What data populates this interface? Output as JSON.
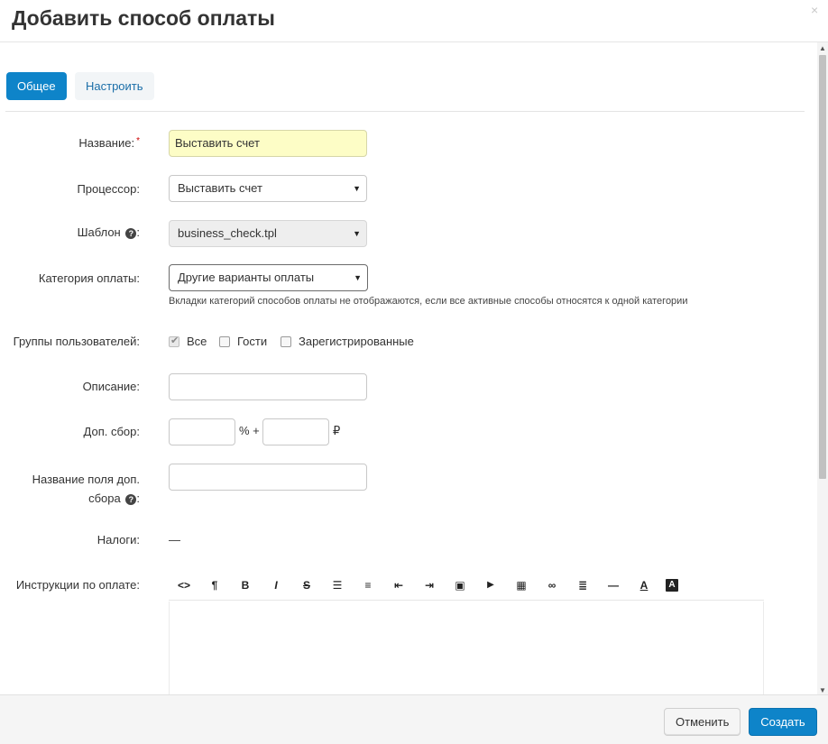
{
  "dialog": {
    "title": "Добавить способ оплаты",
    "close_glyph": "×"
  },
  "tabs": [
    {
      "label": "Общее",
      "active": true
    },
    {
      "label": "Настроить",
      "active": false
    }
  ],
  "form": {
    "name": {
      "label": "Название:",
      "required_mark": "*",
      "value": "Выставить счет"
    },
    "processor": {
      "label": "Процессор:",
      "value": "Выставить счет"
    },
    "template": {
      "label": "Шаблон",
      "help": "?",
      "colon": ":",
      "value": "business_check.tpl"
    },
    "category": {
      "label": "Категория оплаты:",
      "value": "Другие варианты оплаты",
      "hint": "Вкладки категорий способов оплаты не отображаются, если все активные способы относятся к одной категории"
    },
    "user_groups": {
      "label": "Группы пользователей:",
      "options": [
        {
          "label": "Все",
          "checked": true
        },
        {
          "label": "Гости",
          "checked": false
        },
        {
          "label": "Зарегистрированные",
          "checked": false
        }
      ]
    },
    "description": {
      "label": "Описание:",
      "value": ""
    },
    "surcharge": {
      "label": "Доп. сбор:",
      "percent_value": "",
      "percent_sign": "% +",
      "fixed_value": "",
      "currency": "₽"
    },
    "surcharge_name": {
      "label_line1": "Название поля доп.",
      "label_line2": "сбора",
      "help": "?",
      "colon": ":",
      "value": ""
    },
    "taxes": {
      "label": "Налоги:",
      "value": "—"
    },
    "instructions": {
      "label": "Инструкции по оплате:",
      "toolbar": [
        {
          "name": "html-code-icon",
          "glyph": "<>"
        },
        {
          "name": "paragraph-icon",
          "glyph": "¶"
        },
        {
          "name": "bold-icon",
          "glyph": "B"
        },
        {
          "name": "italic-icon",
          "glyph": "I"
        },
        {
          "name": "strikethrough-icon",
          "glyph": "S"
        },
        {
          "name": "unordered-list-icon",
          "glyph": "☰"
        },
        {
          "name": "ordered-list-icon",
          "glyph": "≡"
        },
        {
          "name": "outdent-icon",
          "glyph": "⇤"
        },
        {
          "name": "indent-icon",
          "glyph": "⇥"
        },
        {
          "name": "image-icon",
          "glyph": "▣"
        },
        {
          "name": "video-icon",
          "glyph": "▶"
        },
        {
          "name": "table-icon",
          "glyph": "▦"
        },
        {
          "name": "link-icon",
          "glyph": "∞"
        },
        {
          "name": "align-icon",
          "glyph": "≣"
        },
        {
          "name": "horizontal-rule-icon",
          "glyph": "—"
        },
        {
          "name": "font-color-icon",
          "glyph": "A"
        },
        {
          "name": "background-color-icon",
          "glyph": "A"
        }
      ]
    }
  },
  "footer": {
    "cancel_label": "Отменить",
    "create_label": "Создать"
  },
  "colors": {
    "accent": "#0e84c9",
    "highlight_input": "#fdfdc6"
  }
}
